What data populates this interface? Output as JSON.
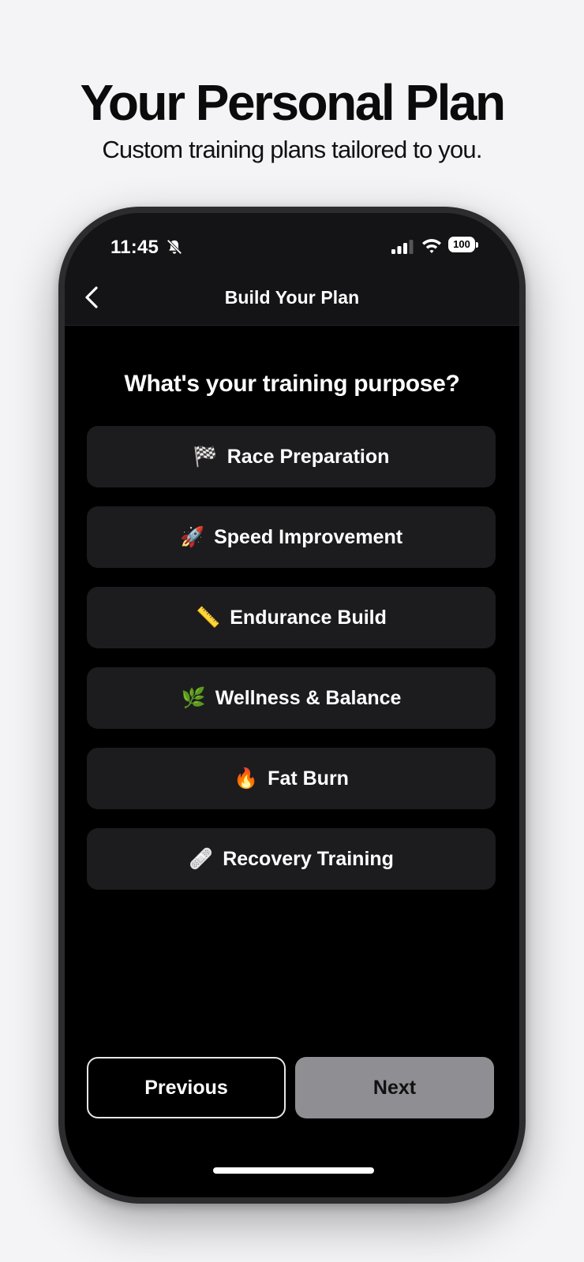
{
  "promo": {
    "title": "Your Personal Plan",
    "subtitle": "Custom training plans tailored to you."
  },
  "status_bar": {
    "time": "11:45",
    "battery": "100",
    "icons": [
      "bell-slash-icon",
      "cellular-signal-icon",
      "wifi-icon",
      "battery-icon"
    ]
  },
  "nav": {
    "title": "Build Your Plan",
    "back_icon": "chevron-left-icon"
  },
  "question": "What's your training purpose?",
  "options": [
    {
      "emoji": "🏁",
      "label": "Race Preparation"
    },
    {
      "emoji": "🚀",
      "label": "Speed Improvement"
    },
    {
      "emoji": "📏",
      "label": "Endurance Build"
    },
    {
      "emoji": "🌿",
      "label": "Wellness & Balance"
    },
    {
      "emoji": "🔥",
      "label": "Fat Burn"
    },
    {
      "emoji": "🩹",
      "label": "Recovery Training"
    }
  ],
  "buttons": {
    "previous": "Previous",
    "next": "Next"
  },
  "colors": {
    "background": "#f4f4f6",
    "screen": "#000000",
    "card": "#1c1c1e",
    "next_button": "#8e8e93"
  }
}
